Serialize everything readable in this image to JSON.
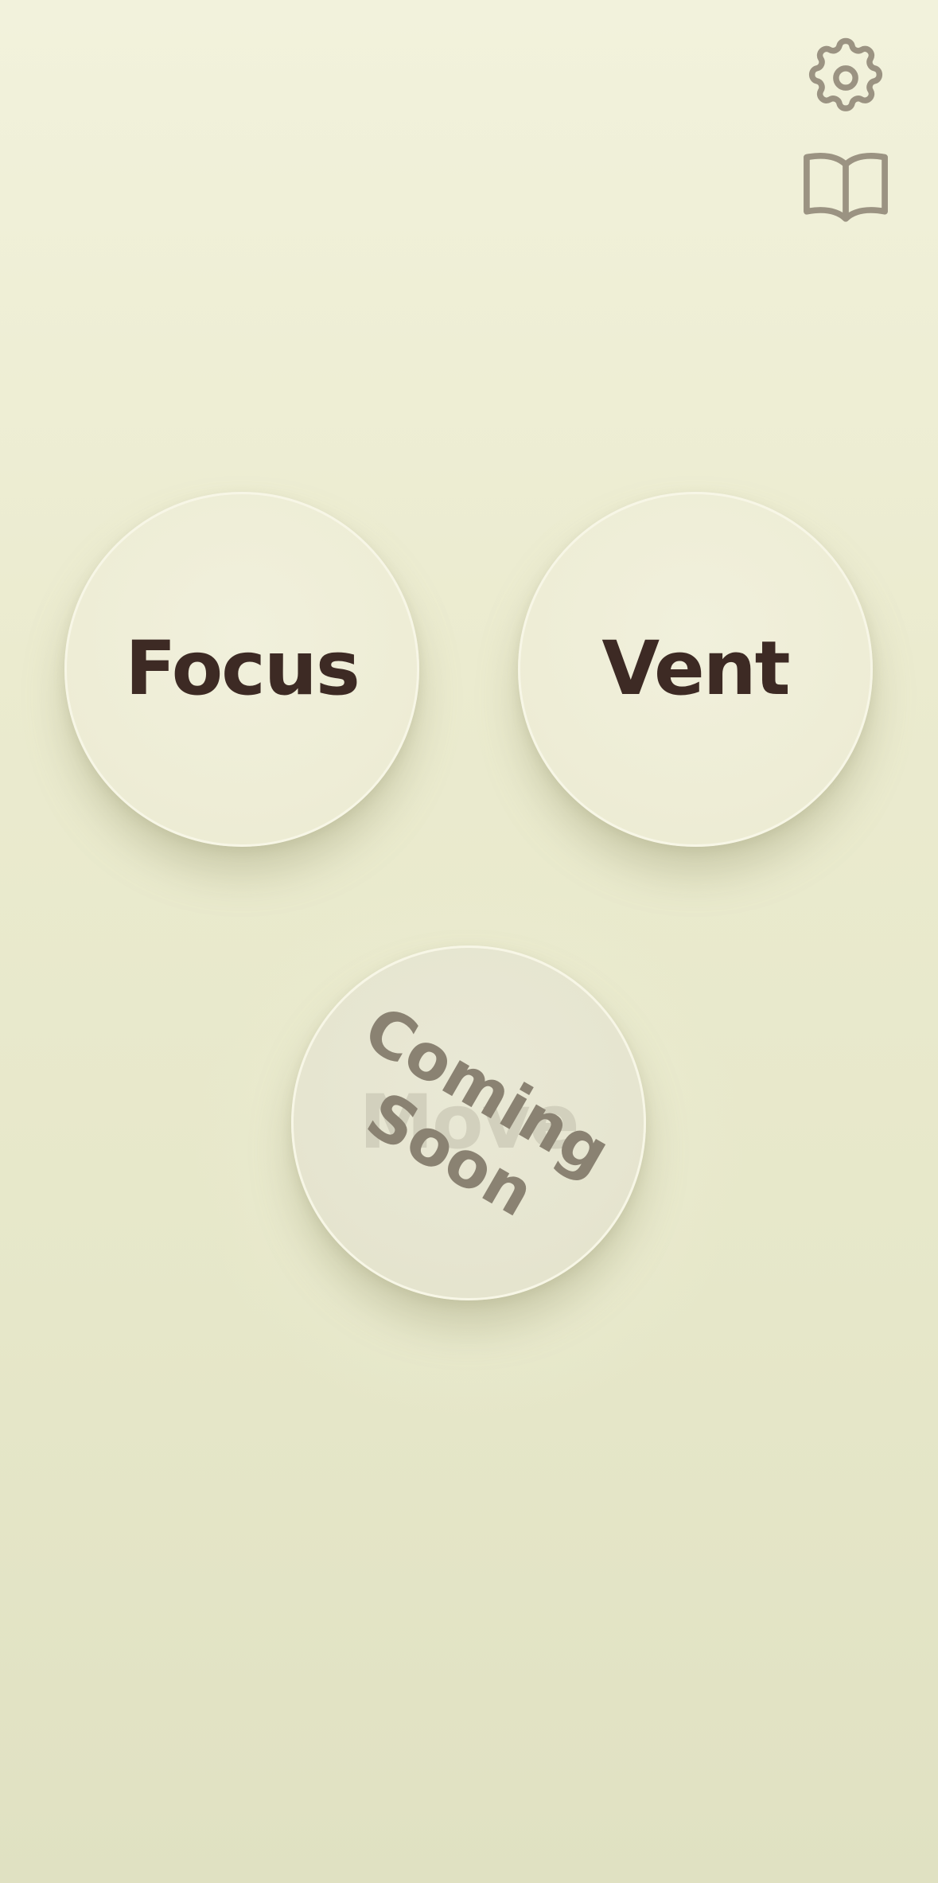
{
  "header": {
    "icons": [
      "settings-gear-icon",
      "book-icon"
    ]
  },
  "buttons": {
    "focus_label": "Focus",
    "vent_label": "Vent",
    "move_label": "Move"
  },
  "move_overlay": {
    "line1": "Coming",
    "line2": "Soon"
  },
  "colors": {
    "background": "#ebebcf",
    "circle": "#eeedd6",
    "label_text": "#3d2a24",
    "icon": "#9b9382",
    "coming_soon_text": "#8a8272"
  }
}
